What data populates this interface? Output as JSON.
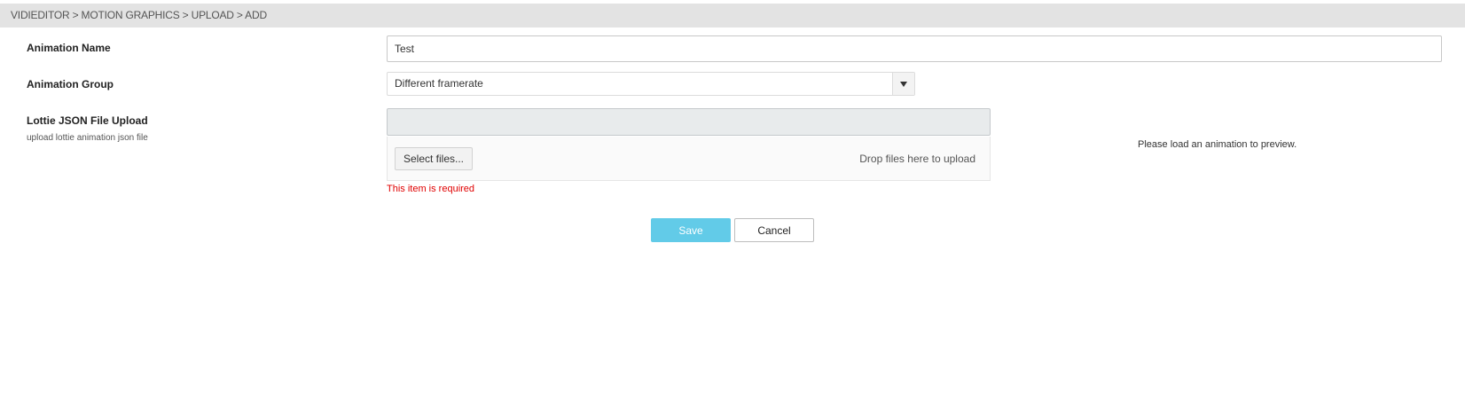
{
  "breadcrumb": {
    "text": "VIDIEDITOR > MOTION GRAPHICS > UPLOAD > ADD"
  },
  "form": {
    "animation_name": {
      "label": "Animation Name",
      "value": "Test"
    },
    "animation_group": {
      "label": "Animation Group",
      "selected": "Different framerate",
      "arrow_icon": "triangle-down-icon"
    },
    "lottie_upload": {
      "label": "Lottie JSON File Upload",
      "sublabel": "upload lottie animation json file",
      "select_button": "Select files...",
      "drop_hint": "Drop files here to upload",
      "error": "This item is required"
    }
  },
  "preview": {
    "message": "Please load an animation to preview."
  },
  "actions": {
    "save": "Save",
    "cancel": "Cancel"
  },
  "colors": {
    "accent": "#62cbe8",
    "error": "#e00000",
    "breadcrumb_bg": "#e3e3e3"
  }
}
